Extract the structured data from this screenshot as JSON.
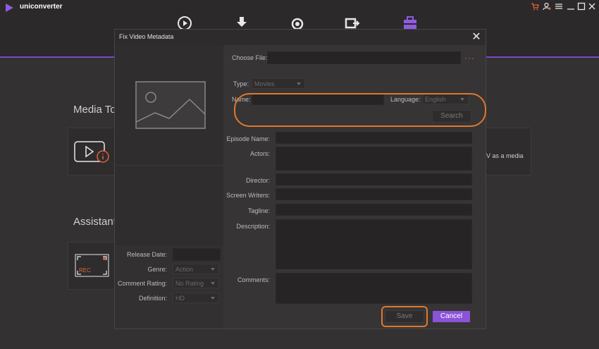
{
  "app": {
    "title": "uniconverter"
  },
  "background": {
    "media_heading": "Media Too",
    "assistant_heading": "Assistant",
    "card_text": "V as a media",
    "rec_label": "REC"
  },
  "dialog": {
    "title": "Fix Video Metadata",
    "choose_file_label": "Choose File:",
    "choose_file_dots": "···",
    "type_label": "Type:",
    "type_value": "Movies",
    "name_label": "Name:",
    "language_label": "Language:",
    "language_value": "English",
    "search_label": "Search",
    "episode_name_label": "Episode Name:",
    "actors_label": "Actors:",
    "director_label": "Director:",
    "screen_writers_label": "Screen Writers:",
    "tagline_label": "Tagline:",
    "description_label": "Description:",
    "comments_label": "Comments:",
    "release_date_label": "Release Date:",
    "genre_label": "Genre:",
    "genre_value": "Action",
    "comment_rating_label": "Comment Rating:",
    "comment_rating_value": "No Rating",
    "definition_label": "Definition:",
    "definition_value": "HD",
    "save_label": "Save",
    "cancel_label": "Cancel",
    "close_glyph": "✕"
  },
  "colors": {
    "accent": "#8c52d8",
    "highlight": "#e0782e"
  }
}
